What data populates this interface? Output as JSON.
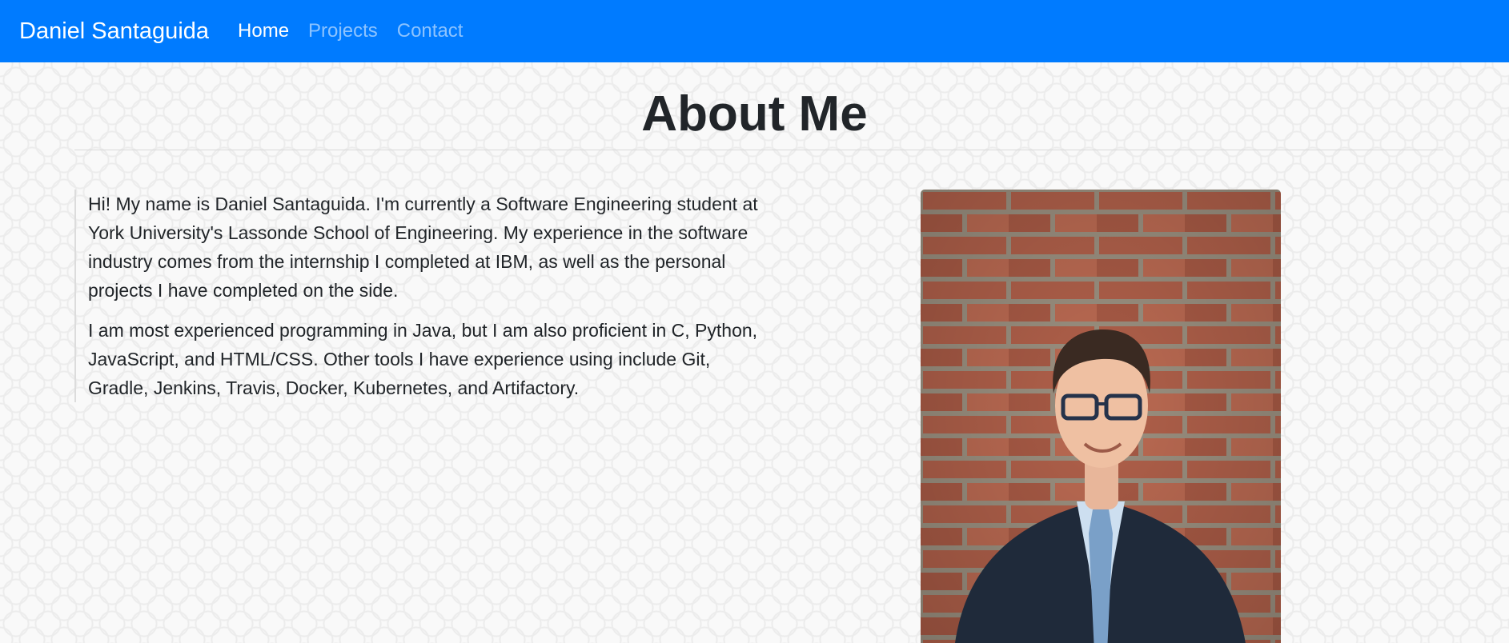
{
  "navbar": {
    "brand": "Daniel Santaguida",
    "links": [
      {
        "label": "Home",
        "active": true
      },
      {
        "label": "Projects",
        "active": false
      },
      {
        "label": "Contact",
        "active": false
      }
    ],
    "color": "#007bff"
  },
  "main": {
    "title": "About Me",
    "paragraphs": [
      "Hi! My name is Daniel Santaguida. I'm currently a Software Engineering student at York University's Lassonde School of Engineering. My experience in the software industry comes from the internship I completed at IBM, as well as the personal projects I have completed on the side.",
      "I am most experienced programming in Java, but I am also proficient in C, Python, JavaScript, and HTML/CSS. Other tools I have experience using include Git, Gradle, Jenkins, Travis, Docker, Kubernetes, and Artifactory."
    ],
    "photo": {
      "subject": "portrait-photo",
      "background": "brick-wall"
    }
  }
}
